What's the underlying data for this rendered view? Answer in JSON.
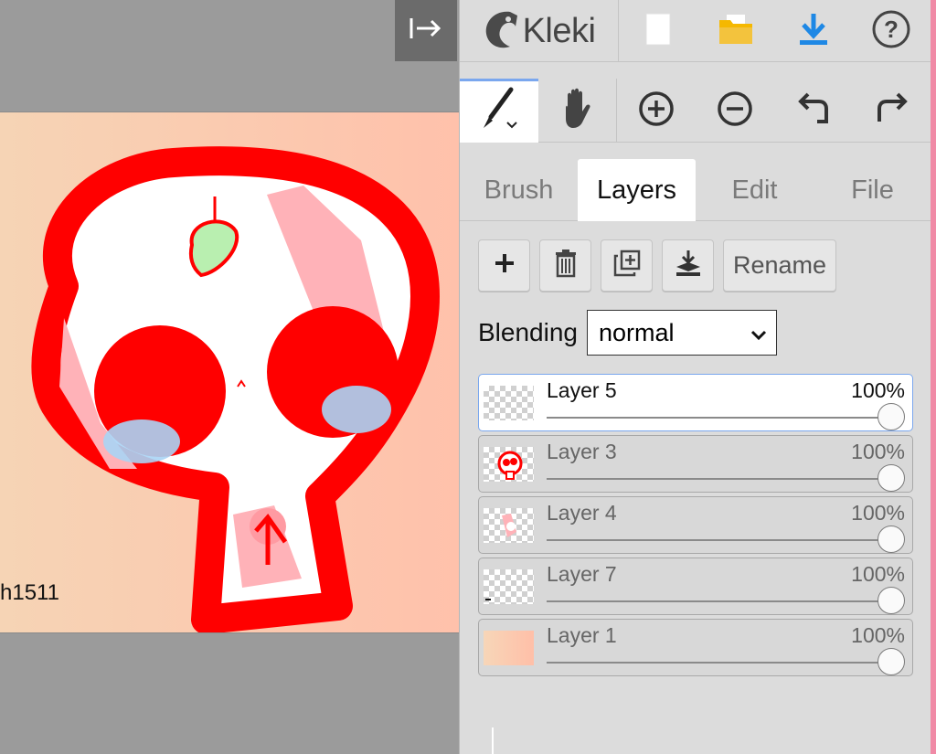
{
  "app": {
    "name": "Kleki"
  },
  "canvas": {
    "signature": "h1511"
  },
  "top_bar": {
    "icons": [
      "new-file-icon",
      "open-folder-icon",
      "download-icon",
      "help-icon"
    ]
  },
  "toolbar": {
    "tools": [
      "brush-tool",
      "hand-tool",
      "zoom-in",
      "zoom-out",
      "undo",
      "redo"
    ]
  },
  "tabs": [
    {
      "label": "Brush",
      "active": false
    },
    {
      "label": "Layers",
      "active": true
    },
    {
      "label": "Edit",
      "active": false
    },
    {
      "label": "File",
      "active": false
    }
  ],
  "layer_actions": {
    "rename_label": "Rename"
  },
  "blending": {
    "label": "Blending",
    "value": "normal"
  },
  "layers": [
    {
      "name": "Layer 5",
      "opacity": "100%",
      "active": true
    },
    {
      "name": "Layer 3",
      "opacity": "100%",
      "active": false
    },
    {
      "name": "Layer 4",
      "opacity": "100%",
      "active": false
    },
    {
      "name": "Layer 7",
      "opacity": "100%",
      "active": false
    },
    {
      "name": "Layer 1",
      "opacity": "100%",
      "active": false
    }
  ],
  "colors": {
    "accent": "#7aa7ee",
    "download": "#1e88e5",
    "folder": "#f5b800",
    "skull_red": "#ff0000"
  }
}
